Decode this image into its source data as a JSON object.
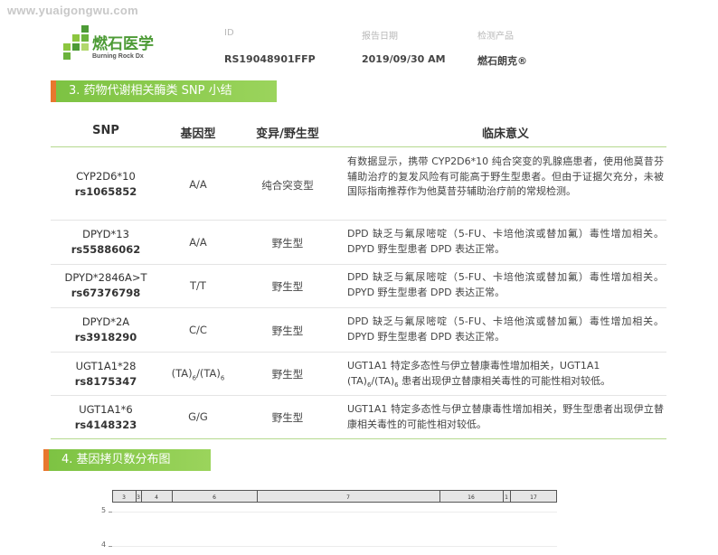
{
  "watermark": "www.yuaigongwu.com",
  "logo": {
    "cn": "燃石医学",
    "en": "Burning Rock Dx"
  },
  "header": {
    "id_label": "ID",
    "date_label": "报告日期",
    "product_label": "检测产品",
    "id_value": "RS19048901FFP",
    "date_value": "2019/09/30 AM",
    "product_value": "燃石朗克®"
  },
  "section3": {
    "title": "3. 药物代谢相关酶类 SNP 小结"
  },
  "table": {
    "headers": [
      "SNP",
      "基因型",
      "变异/野生型",
      "临床意义"
    ],
    "rows": [
      {
        "snp": "CYP2D6*10",
        "rs": "rs1065852",
        "genotype": "A/A",
        "variant": "纯合突变型",
        "significance": "有数据显示，携带 CYP2D6*10 纯合突变的乳腺癌患者，使用他莫昔芬辅助治疗的复发风险有可能高于野生型患者。但由于证据欠充分，未被国际指南推荐作为他莫昔芬辅助治疗前的常规检测。"
      },
      {
        "snp": "DPYD*13",
        "rs": "rs55886062",
        "genotype": "A/A",
        "variant": "野生型",
        "significance": "DPD 缺乏与氟尿嘧啶（5-FU、卡培他滨或替加氟）毒性增加相关。DPYD 野生型患者 DPD 表达正常。"
      },
      {
        "snp": "DPYD*2846A>T",
        "rs": "rs67376798",
        "genotype": "T/T",
        "variant": "野生型",
        "significance": "DPD 缺乏与氟尿嘧啶（5-FU、卡培他滨或替加氟）毒性增加相关。DPYD 野生型患者 DPD 表达正常。"
      },
      {
        "snp": "DPYD*2A",
        "rs": "rs3918290",
        "genotype": "C/C",
        "variant": "野生型",
        "significance": "DPD 缺乏与氟尿嘧啶（5-FU、卡培他滨或替加氟）毒性增加相关。DPYD 野生型患者 DPD 表达正常。"
      },
      {
        "snp": "UGT1A1*28",
        "rs": "rs8175347",
        "genotype_parts": [
          "(TA)",
          "6",
          "/(TA)",
          "6"
        ],
        "variant": "野生型",
        "significance_line1": "UGT1A1 特定多态性与伊立替康毒性增加相关，UGT1A1",
        "significance_parts": [
          "(TA)",
          "6",
          "/(TA)",
          "6",
          " 患者出现伊立替康相关毒性的可能性相对较低。"
        ]
      },
      {
        "snp": "UGT1A1*6",
        "rs": "rs4148323",
        "genotype": "G/G",
        "variant": "野生型",
        "significance": "UGT1A1 特定多态性与伊立替康毒性增加相关，野生型患者出现伊立替康相关毒性的可能性相对较低。"
      }
    ]
  },
  "section4": {
    "title": "4. 基因拷贝数分布图"
  },
  "chart_data": {
    "type": "scatter",
    "chromosomes": [
      "3",
      "3",
      "4",
      "6",
      "7",
      "16",
      "1",
      "17"
    ],
    "y_ticks": [
      "5",
      "4"
    ]
  },
  "colors": {
    "accent_green": "#7cc242",
    "accent_orange": "#e8772e",
    "brand_green": "#4d9b36"
  }
}
